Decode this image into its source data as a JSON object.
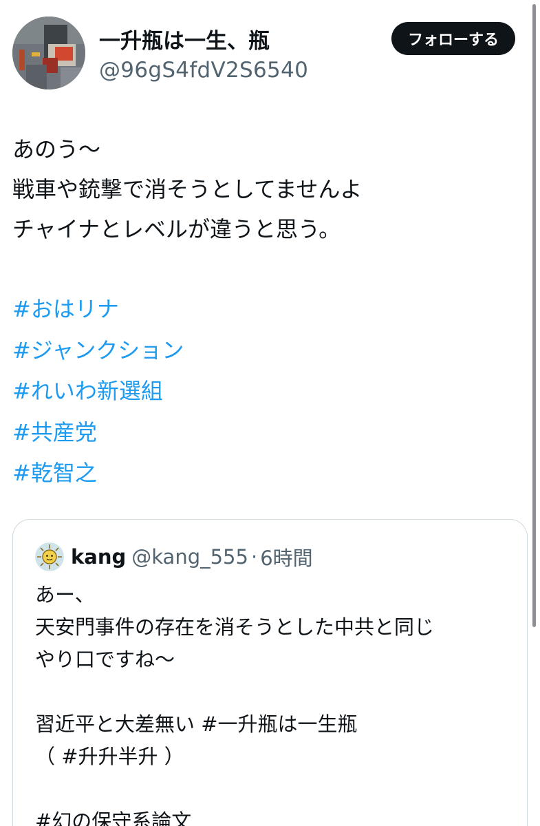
{
  "author": {
    "display_name": "一升瓶は一生、瓶",
    "handle": "@96gS4fdV2S6540",
    "avatar_icon": "profile-avatar"
  },
  "follow_button": {
    "label": "フォローする"
  },
  "tweet": {
    "lines": [
      "あのう〜",
      "戦車や銃撃で消そうとしてませんよ",
      "チャイナとレベルが違うと思う。"
    ],
    "hashtags": [
      "#おはリナ",
      "#ジャンクション",
      "#れいわ新選組",
      "#共産党",
      "#乾智之"
    ]
  },
  "quoted_tweet": {
    "name": "kang",
    "handle": "@kang_555",
    "separator": "·",
    "time": "6時間",
    "avatar_icon": "sun-face-avatar",
    "lines": [
      "あー、",
      "天安門事件の存在を消そうとした中共と同じ",
      "やり口ですね〜",
      "",
      "習近平と大差無い #一升瓶は一生瓶",
      "（ #升升半升 ）",
      "",
      "#幻の保守系論文"
    ]
  },
  "colors": {
    "text": "#0f1419",
    "secondary_text": "#536471",
    "link": "#1d9bf0",
    "border": "#cfd9de",
    "follow_button_bg": "#0f1419"
  }
}
